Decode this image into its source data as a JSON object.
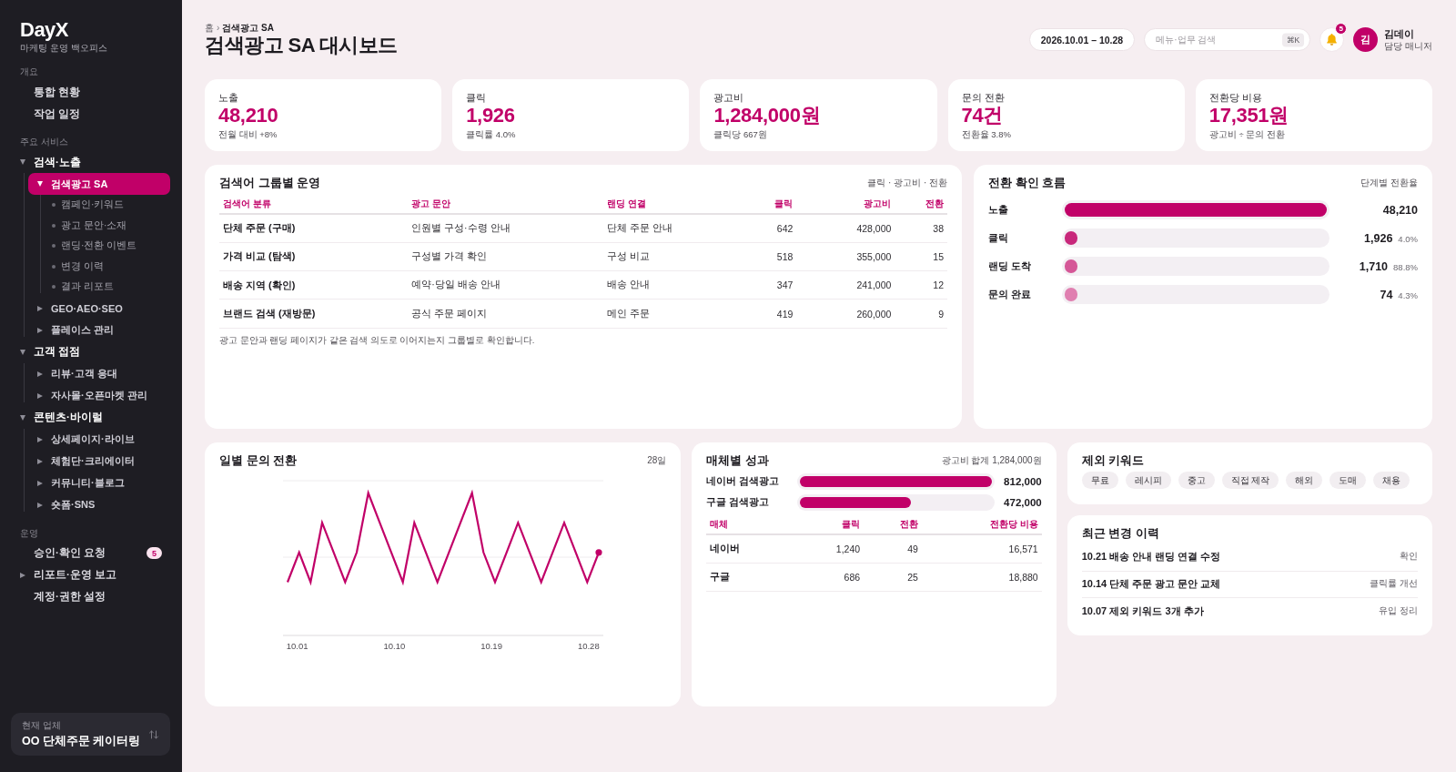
{
  "sidebar": {
    "brand": "DayX",
    "subtitle": "마케팅 운영 백오피스",
    "sections": [
      {
        "title": "개요",
        "items": [
          {
            "label": "통합 현황",
            "selected": false
          },
          {
            "label": "작업 일정",
            "selected": false
          }
        ]
      },
      {
        "title": "주요 서비스",
        "items": [
          {
            "label": "검색·노출",
            "selected": false,
            "expanded": true,
            "children": [
              {
                "label": "검색광고 SA",
                "selected": true,
                "expanded": true,
                "children": [
                  {
                    "label": "캠페인·키워드",
                    "selected": false
                  },
                  {
                    "label": "광고 문안·소재",
                    "selected": false
                  },
                  {
                    "label": "랜딩·전환 이벤트",
                    "selected": false
                  },
                  {
                    "label": "변경 이력",
                    "selected": false
                  },
                  {
                    "label": "결과 리포트",
                    "selected": false
                  }
                ]
              },
              {
                "label": "GEO·AEO·SEO",
                "selected": false,
                "expanded": false
              },
              {
                "label": "플레이스 관리",
                "selected": false,
                "expanded": false
              }
            ]
          },
          {
            "label": "고객 접점",
            "selected": false,
            "expanded": true,
            "children": [
              {
                "label": "리뷰·고객 응대",
                "selected": false,
                "expanded": false
              },
              {
                "label": "자사몰·오픈마켓 관리",
                "selected": false,
                "expanded": false
              }
            ]
          },
          {
            "label": "콘텐츠·바이럴",
            "selected": false,
            "expanded": true,
            "children": [
              {
                "label": "상세페이지·라이브",
                "selected": false,
                "expanded": false
              },
              {
                "label": "체험단·크리에이터",
                "selected": false,
                "expanded": false
              },
              {
                "label": "커뮤니티·블로그",
                "selected": false,
                "expanded": false
              },
              {
                "label": "숏폼·SNS",
                "selected": false,
                "expanded": false
              }
            ]
          }
        ]
      },
      {
        "title": "운영",
        "items": [
          {
            "label": "승인·확인 요청",
            "selected": false,
            "badge": "5"
          },
          {
            "label": "리포트·운영 보고",
            "selected": false,
            "expanded": false
          },
          {
            "label": "계정·권한 설정",
            "selected": false
          }
        ]
      }
    ],
    "workspace": {
      "caption": "현재 업체",
      "name": "OO 단체주문 케이터링"
    }
  },
  "header": {
    "breadcrumb": {
      "items": [
        "홈",
        "검색광고 SA"
      ],
      "separator": "›"
    },
    "title": "검색광고 SA 대시보드",
    "date_range": "2026.10.01 – 10.28",
    "search": {
      "placeholder": "메뉴·업무 검색",
      "shortcut": "⌘K"
    },
    "notifications": "5",
    "user": {
      "initial": "김",
      "name": "김데이",
      "role": "담당 매니저"
    }
  },
  "kpis": [
    {
      "label": "노출",
      "value": "48,210",
      "note": "전월 대비 +8%"
    },
    {
      "label": "클릭",
      "value": "1,926",
      "note": "클릭률 4.0%"
    },
    {
      "label": "광고비",
      "value": "1,284,000원",
      "note": "클릭당 667원"
    },
    {
      "label": "문의 전환",
      "value": "74건",
      "note": "전환율 3.8%"
    },
    {
      "label": "전환당 비용",
      "value": "17,351원",
      "note": "광고비 ÷ 문의 전환"
    }
  ],
  "keyword_groups": {
    "title": "검색어 그룹별 운영",
    "legend": "클릭 · 광고비 · 전환",
    "columns": [
      {
        "label": "검색어 분류",
        "kind": "label"
      },
      {
        "label": "광고 문안",
        "kind": "text"
      },
      {
        "label": "랜딩 연결",
        "kind": "text"
      },
      {
        "label": "클릭",
        "kind": "number"
      },
      {
        "label": "광고비",
        "kind": "number"
      },
      {
        "label": "전환",
        "kind": "number"
      }
    ],
    "rows": [
      [
        "단체 주문 (구매)",
        "인원별 구성·수령 안내",
        "단체 주문 안내",
        "642",
        "428,000",
        "38"
      ],
      [
        "가격 비교 (탐색)",
        "구성별 가격 확인",
        "구성 비교",
        "518",
        "355,000",
        "15"
      ],
      [
        "배송 지역 (확인)",
        "예약·당일 배송 안내",
        "배송 안내",
        "347",
        "241,000",
        "12"
      ],
      [
        "브랜드 검색 (재방문)",
        "공식 주문 페이지",
        "메인 주문",
        "419",
        "260,000",
        "9"
      ]
    ],
    "note": "광고 문안과 랜딩 페이지가 같은 검색 의도로 이어지는지 그룹별로 확인합니다."
  },
  "funnel": {
    "title": "전환 확인 흐름",
    "legend": "단계별 전환율",
    "steps": [
      {
        "label": "노출",
        "value": "48,210",
        "level": 1,
        "color": "#c10068"
      },
      {
        "label": "클릭",
        "value": "1,926",
        "rate": "4.0%",
        "level": 0.05,
        "color": "#c8287b"
      },
      {
        "label": "랜딩 도착",
        "value": "1,710",
        "rate": "88.8%",
        "level": 0.05,
        "color": "#d55797"
      },
      {
        "label": "문의 완료",
        "value": "74",
        "rate": "4.3%",
        "level": 0.05,
        "color": "#e07fb0"
      }
    ]
  },
  "daily_chart": {
    "title": "일별 문의 전환",
    "period": "28일",
    "x_labels": [
      "10.01",
      "10.10",
      "10.19",
      "10.28"
    ]
  },
  "media": {
    "title": "매체별 성과",
    "total": "광고비 합계 1,284,000원",
    "bars": [
      {
        "label": "네이버 검색광고",
        "value": "812,000",
        "level": 1
      },
      {
        "label": "구글 검색광고",
        "value": "472,000",
        "level": 0.58
      }
    ],
    "columns": [
      {
        "label": "매체",
        "kind": "label"
      },
      {
        "label": "클릭",
        "kind": "number"
      },
      {
        "label": "전환",
        "kind": "number"
      },
      {
        "label": "전환당 비용",
        "kind": "number"
      }
    ],
    "rows": [
      [
        "네이버",
        "1,240",
        "49",
        "16,571"
      ],
      [
        "구글",
        "686",
        "25",
        "18,880"
      ]
    ]
  },
  "excluded_keywords": {
    "title": "제외 키워드",
    "tags": [
      "무료",
      "레시피",
      "중고",
      "직접 제작",
      "해외",
      "도매",
      "채용"
    ]
  },
  "recent_changes": {
    "title": "최근 변경 이력",
    "items": [
      {
        "text": "10.21 배송 안내 랜딩 연결 수정",
        "result": "확인"
      },
      {
        "text": "10.14 단체 주문 광고 문안 교체",
        "result": "클릭률 개선"
      },
      {
        "text": "10.07 제외 키워드 3개 추가",
        "result": "유입 정리"
      }
    ]
  }
}
